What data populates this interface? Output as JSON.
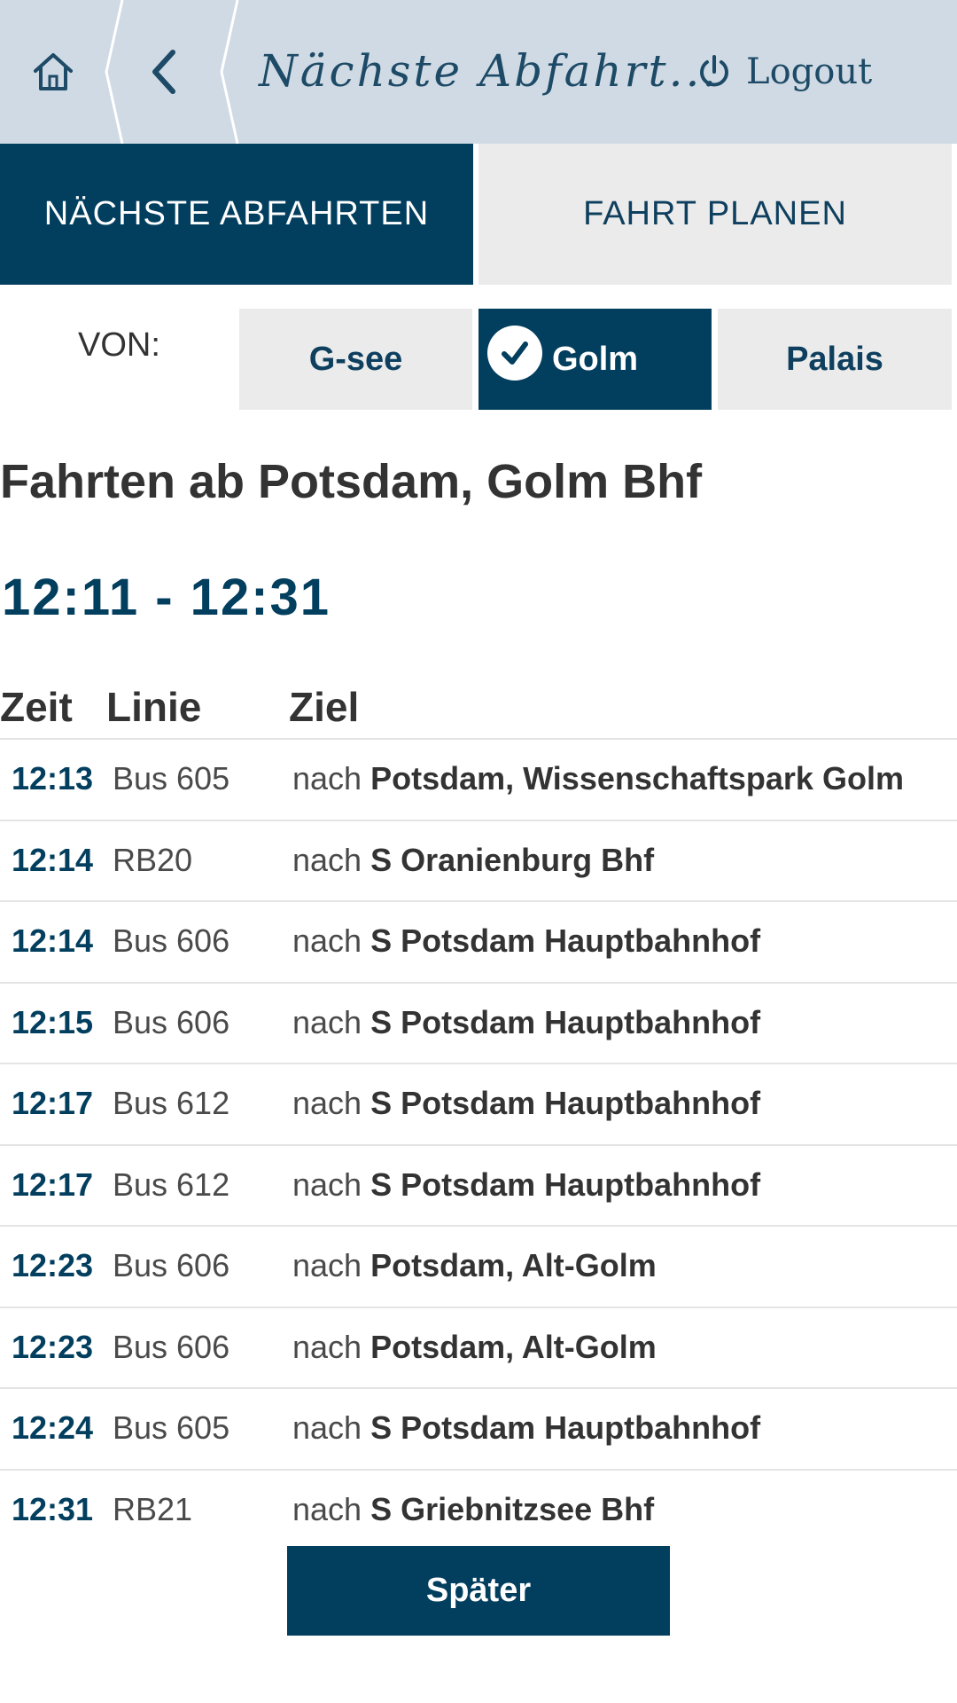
{
  "header": {
    "title": "Nächste Abfahrt...",
    "logout_label": "Logout"
  },
  "tabs": [
    {
      "label": "NÄCHSTE ABFAHRTEN",
      "active": true
    },
    {
      "label": "FAHRT PLANEN",
      "active": false
    }
  ],
  "von": {
    "label": "VON:",
    "stops": [
      {
        "label": "G-see",
        "selected": false
      },
      {
        "label": "Golm",
        "selected": true
      },
      {
        "label": "Palais",
        "selected": false
      }
    ]
  },
  "main": {
    "title": "Fahrten ab Potsdam, Golm Bhf",
    "time_range": "12:11 - 12:31"
  },
  "table": {
    "headers": [
      "Zeit",
      "Linie",
      "Ziel"
    ],
    "rows": [
      {
        "time": "12:13",
        "line": "Bus 605",
        "prefix": "nach",
        "dest": "Potsdam, Wissenschaftspark Golm"
      },
      {
        "time": "12:14",
        "line": "RB20",
        "prefix": "nach",
        "dest": "S Oranienburg Bhf"
      },
      {
        "time": "12:14",
        "line": "Bus 606",
        "prefix": "nach",
        "dest": "S Potsdam Hauptbahnhof"
      },
      {
        "time": "12:15",
        "line": "Bus 606",
        "prefix": "nach",
        "dest": "S Potsdam Hauptbahnhof"
      },
      {
        "time": "12:17",
        "line": "Bus 612",
        "prefix": "nach",
        "dest": "S Potsdam Hauptbahnhof"
      },
      {
        "time": "12:17",
        "line": "Bus 612",
        "prefix": "nach",
        "dest": "S Potsdam Hauptbahnhof"
      },
      {
        "time": "12:23",
        "line": "Bus 606",
        "prefix": "nach",
        "dest": "Potsdam, Alt-Golm"
      },
      {
        "time": "12:23",
        "line": "Bus 606",
        "prefix": "nach",
        "dest": "Potsdam, Alt-Golm"
      },
      {
        "time": "12:24",
        "line": "Bus 605",
        "prefix": "nach",
        "dest": "S Potsdam Hauptbahnhof"
      },
      {
        "time": "12:31",
        "line": "RB21",
        "prefix": "nach",
        "dest": "S Griebnitzsee Bhf"
      }
    ]
  },
  "later_button": "Später",
  "colors": {
    "primary": "#023e5e",
    "header_bg": "#d0dae4",
    "inactive_bg": "#ebebeb"
  },
  "icons": {
    "home": "home-icon",
    "back": "chevron-left-icon",
    "logout": "power-icon",
    "selected": "check-icon"
  }
}
